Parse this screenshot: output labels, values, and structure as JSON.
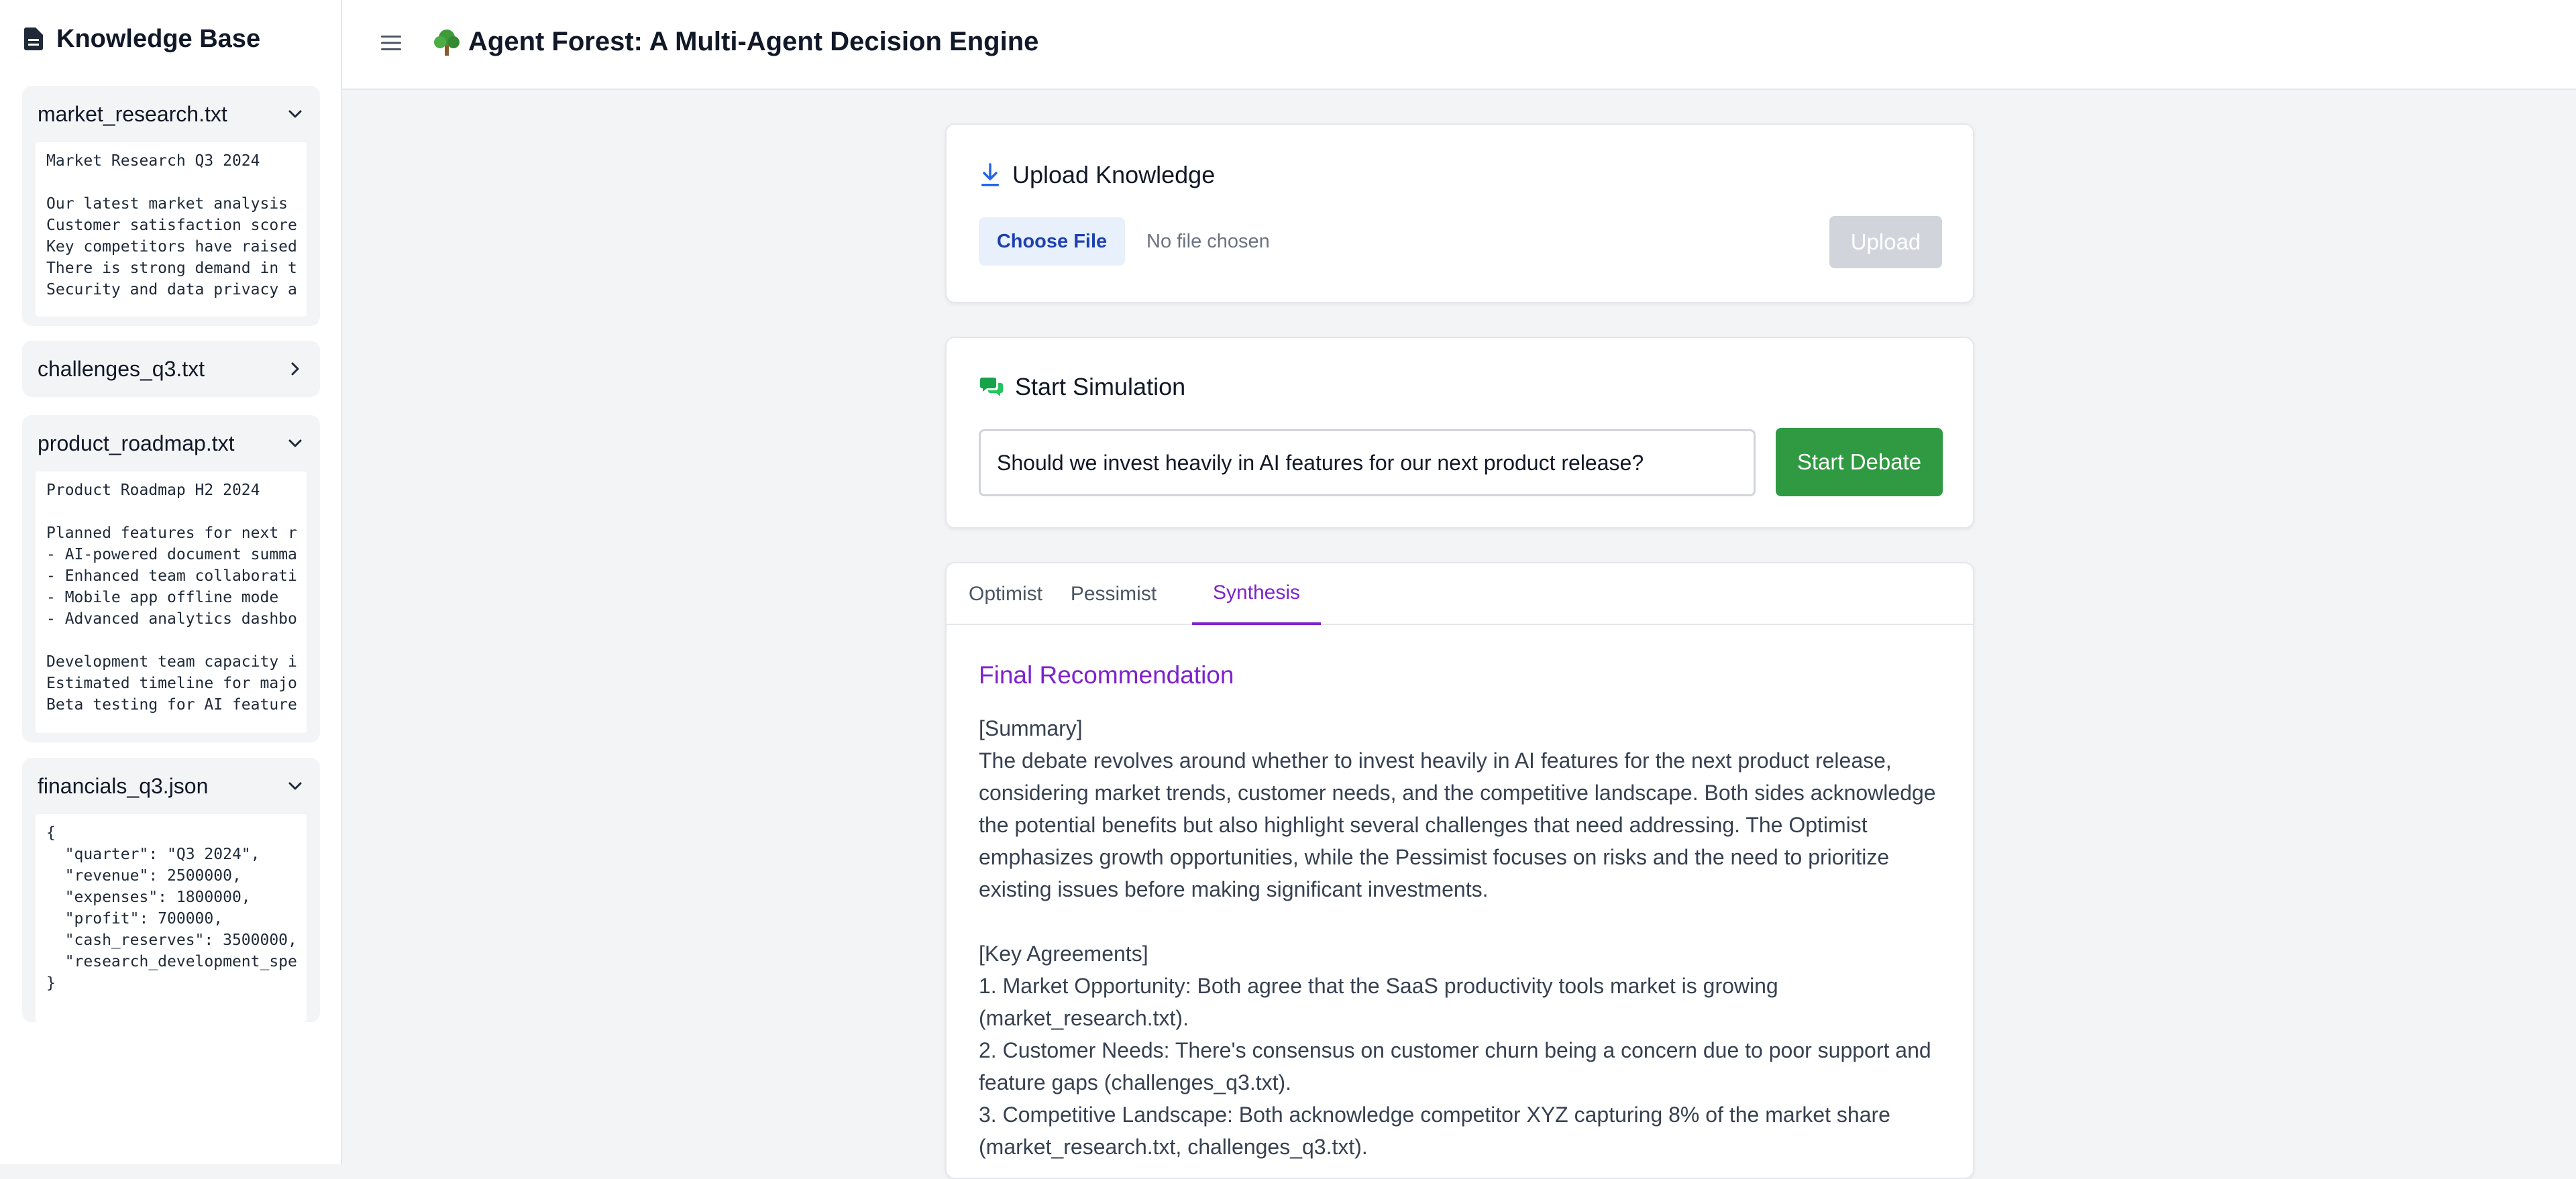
{
  "sidebar": {
    "title": "Knowledge Base",
    "files": [
      {
        "name": "market_research.txt",
        "expanded": true,
        "content": "Market Research Q3 2024\n\nOur latest market analysis\nCustomer satisfaction score\nKey competitors have raised\nThere is strong demand in t\nSecurity and data privacy a"
      },
      {
        "name": "challenges_q3.txt",
        "expanded": false,
        "content": ""
      },
      {
        "name": "product_roadmap.txt",
        "expanded": true,
        "content": "Product Roadmap H2 2024\n\nPlanned features for next r\n- AI-powered document summa\n- Enhanced team collaborati\n- Mobile app offline mode\n- Advanced analytics dashbo\n\nDevelopment team capacity i\nEstimated timeline for majo\nBeta testing for AI feature"
      },
      {
        "name": "financials_q3.json",
        "expanded": true,
        "content": "{\n  \"quarter\": \"Q3 2024\",\n  \"revenue\": 2500000,\n  \"expenses\": 1800000,\n  \"profit\": 700000,\n  \"cash_reserves\": 3500000,\n  \"research_development_spe\n}"
      }
    ]
  },
  "header": {
    "title": "Agent Forest: A Multi-Agent Decision Engine",
    "icon": "tree-icon",
    "menu_icon": "hamburger-menu-icon"
  },
  "upload": {
    "title": "Upload Knowledge",
    "icon": "download-icon",
    "choose_label": "Choose File",
    "no_file_text": "No file chosen",
    "upload_label": "Upload"
  },
  "simulation": {
    "title": "Start Simulation",
    "icon": "chat-bubbles-icon",
    "question": "Should we invest heavily in AI features for our next product release?",
    "start_label": "Start Debate"
  },
  "results": {
    "tabs": [
      {
        "label": "Optimist",
        "active": false
      },
      {
        "label": "Pessimist",
        "active": false
      },
      {
        "label": "Synthesis",
        "active": true
      }
    ],
    "heading": "Final Recommendation",
    "body": "[Summary]\nThe debate revolves around whether to invest heavily in AI features for the next product release, considering market trends, customer needs, and the competitive landscape. Both sides acknowledge the potential benefits but also highlight several challenges that need addressing. The Optimist emphasizes growth opportunities, while the Pessimist focuses on risks and the need to prioritize existing issues before making significant investments.\n\n[Key Agreements]\n1. Market Opportunity: Both agree that the SaaS productivity tools market is growing (market_research.txt).\n2. Customer Needs: There's consensus on customer churn being a concern due to poor support and feature gaps (challenges_q3.txt).\n3. Competitive Landscape: Both acknowledge competitor XYZ capturing 8% of the market share (market_research.txt, challenges_q3.txt)."
  },
  "colors": {
    "accent_purple": "#7e22ce",
    "start_green": "#2f9a41",
    "choose_blue": "#1e40af",
    "upload_disabled": "#d1d5db"
  }
}
